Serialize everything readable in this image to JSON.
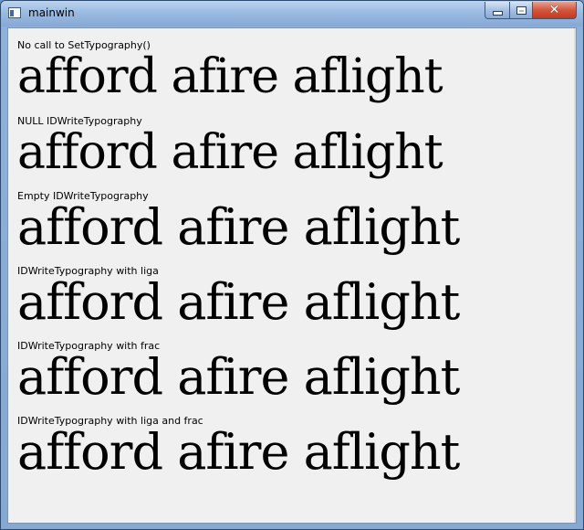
{
  "window": {
    "title": "mainwin"
  },
  "samples": [
    {
      "caption": "No call to SetTypography()",
      "text": "afford afire aflight"
    },
    {
      "caption": "NULL IDWriteTypography",
      "text": "afford afire aflight"
    },
    {
      "caption": "Empty IDWriteTypography",
      "text": "afford afire aflight"
    },
    {
      "caption": "IDWriteTypography with liga",
      "text": "afford afire aflight"
    },
    {
      "caption": "IDWriteTypography with frac",
      "text": "afford afire aflight"
    },
    {
      "caption": "IDWriteTypography with liga and frac",
      "text": "afford afire aflight"
    }
  ],
  "icons": {
    "app": "app-window-icon",
    "minimize": "minimize-icon",
    "maximize": "maximize-icon",
    "close": "close-icon"
  }
}
